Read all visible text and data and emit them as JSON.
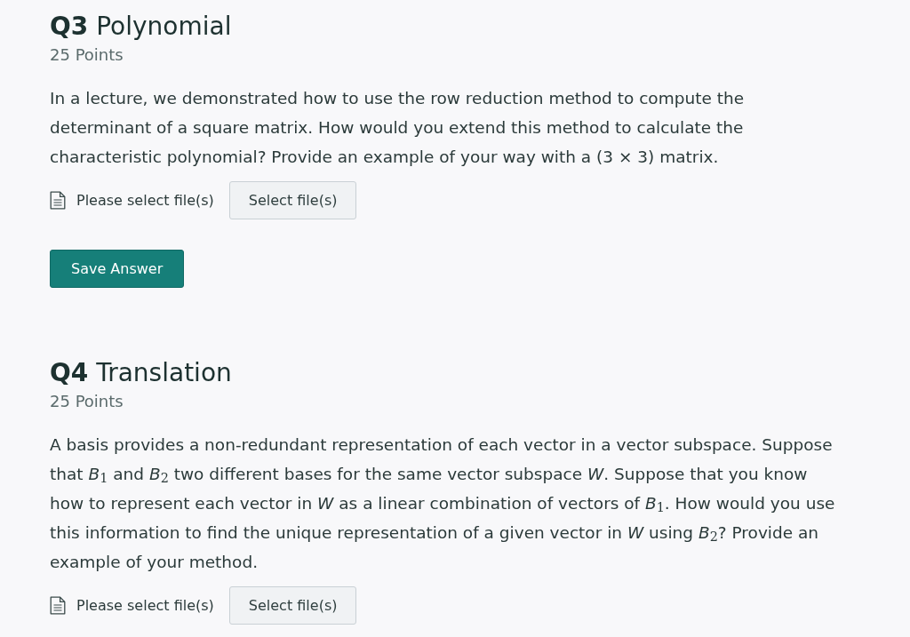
{
  "questions": [
    {
      "title": "**Q3** Polynomial",
      "points": "25 Points",
      "prompt": "In a lecture, we demonstrated how to use the row reduction method to compute the determinant of a square matrix. How would you extend this method to calculate the characteristic polynomial? Provide an example of your way with a (3 × 3) matrix.",
      "upload": {
        "label": "Please select file(s)",
        "button": "Select file(s)"
      },
      "save_button": "Save Answer"
    },
    {
      "title": "**Q4** Translation",
      "points": "25 Points",
      "prompt": "A basis provides a non-redundant representation of each vector in a vector subspace. Suppose that *B*$_{1}$ and *B*$_{2}$ two different bases for the same vector subspace *W*. Suppose that you know how to represent each vector in *W* as a linear combination of vectors of *B*$_{1}$. How would you use this information to find the unique representation of a given vector in *W* using *B*$_{2}$? Provide an example of your method.",
      "upload": {
        "label": "Please select file(s)",
        "button": "Select file(s)"
      }
    }
  ]
}
